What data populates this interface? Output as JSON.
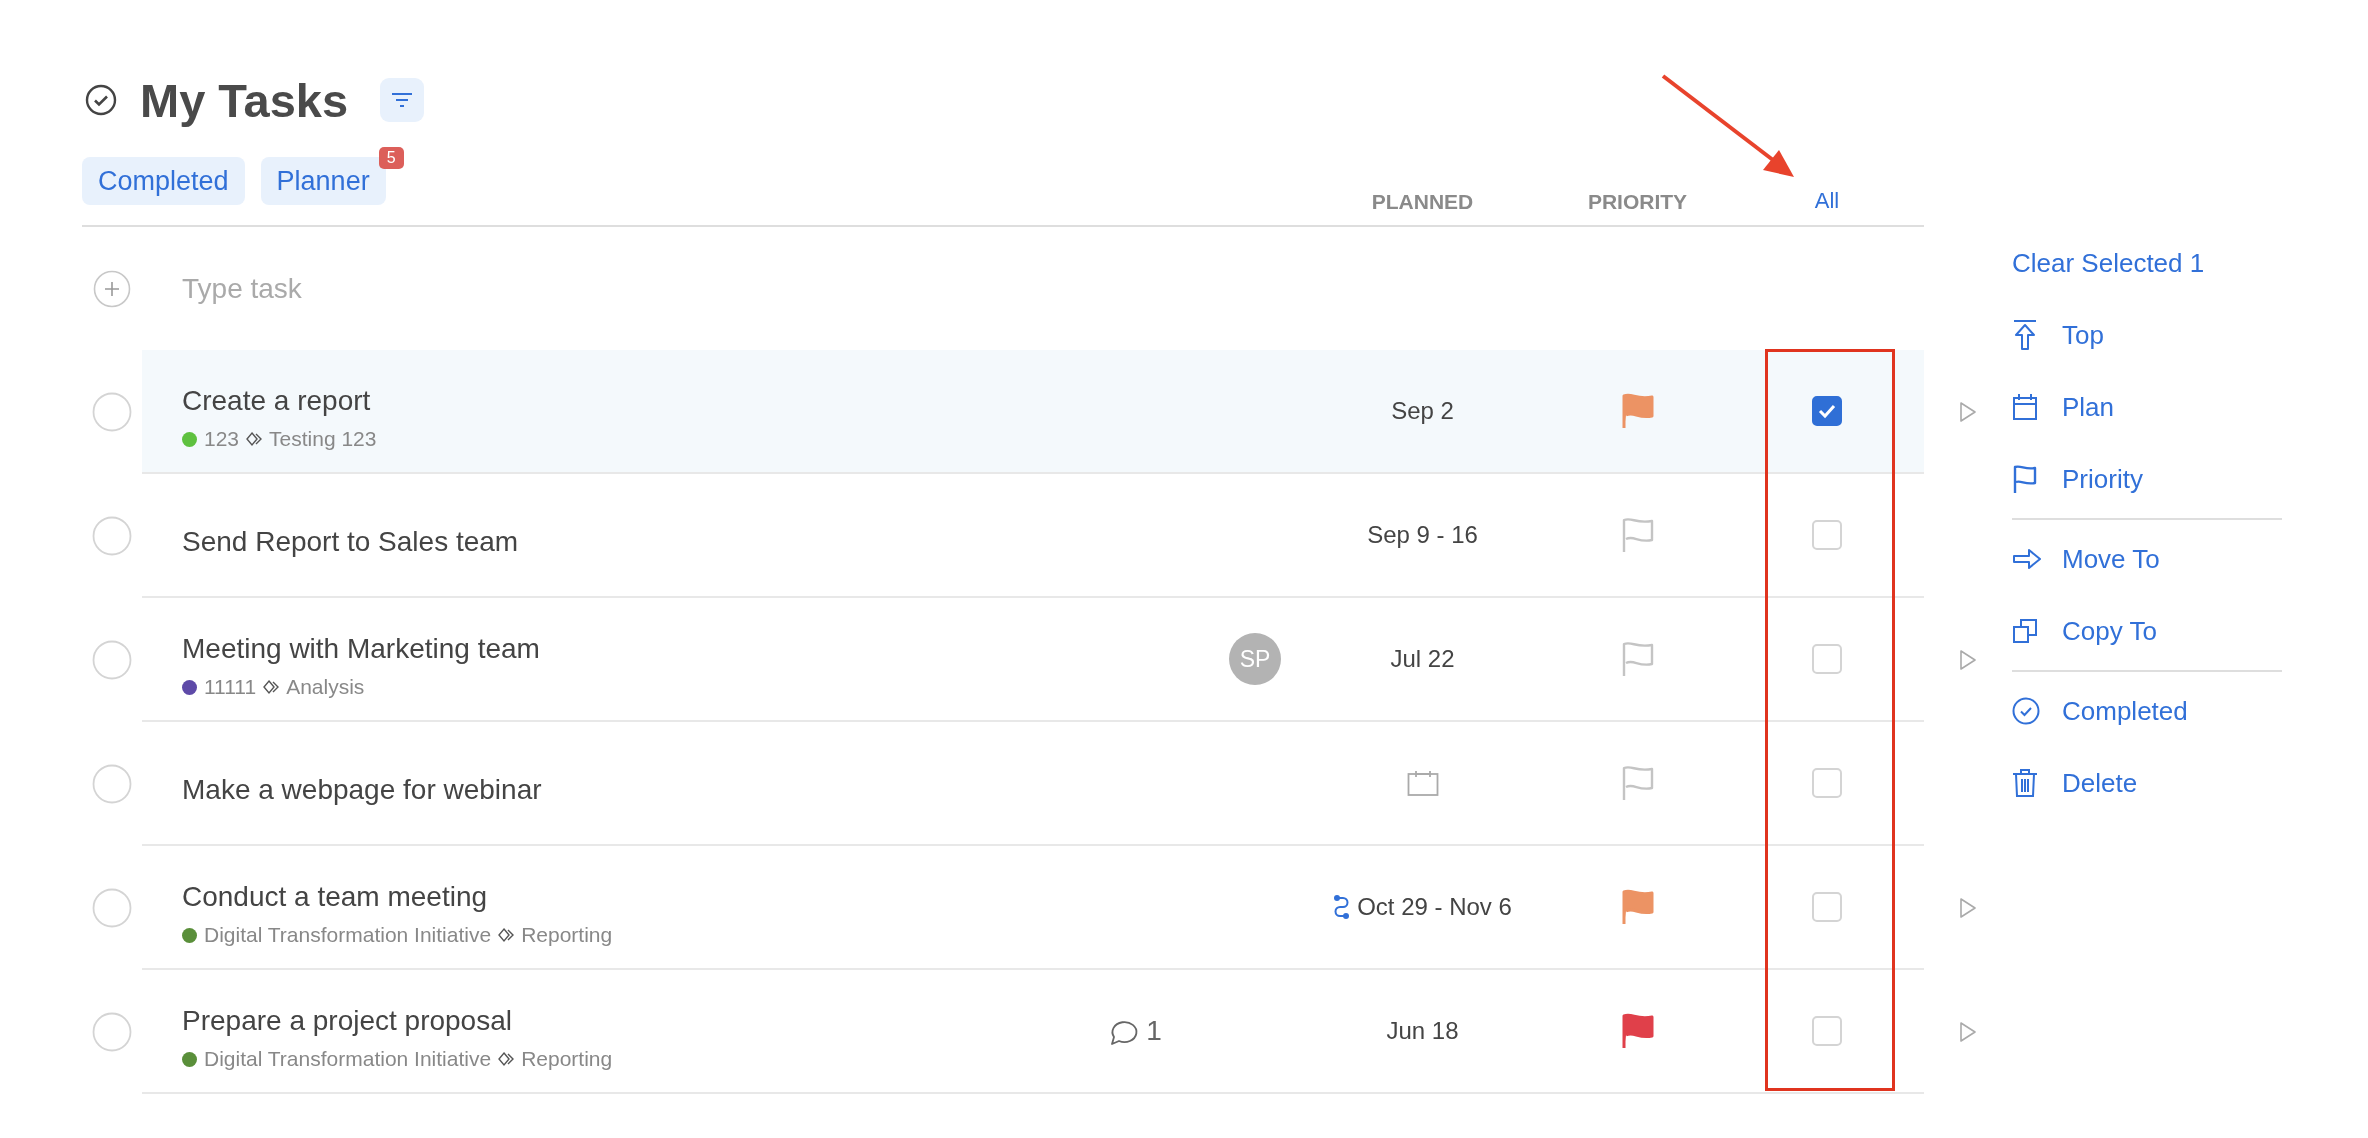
{
  "header": {
    "title": "My Tasks"
  },
  "filters": [
    {
      "label": "Completed"
    },
    {
      "label": "Planner",
      "badge": "5"
    }
  ],
  "columns": {
    "planned": "PLANNED",
    "priority": "PRIORITY",
    "select_all": "All"
  },
  "new_task": {
    "placeholder": "Type task"
  },
  "tasks": [
    {
      "title": "Create a report",
      "project": "123",
      "color": "#5ec13f",
      "section": "Testing 123",
      "planned": "Sep 2",
      "recurring": false,
      "priority": {
        "set": true,
        "color": "#ec9364"
      },
      "selected": true,
      "expandable": true
    },
    {
      "title": "Send Report to Sales team",
      "planned": "Sep 9 - 16",
      "recurring": false,
      "priority": {
        "set": false
      },
      "selected": false,
      "expandable": false
    },
    {
      "title": "Meeting with Marketing team",
      "project": "11111",
      "color": "#5e4aa8",
      "section": "Analysis",
      "assignee": "SP",
      "planned": "Jul 22",
      "recurring": false,
      "priority": {
        "set": false
      },
      "selected": false,
      "expandable": true
    },
    {
      "title": "Make a webpage for webinar",
      "recurring": false,
      "priority": {
        "set": false
      },
      "selected": false,
      "expandable": false
    },
    {
      "title": "Conduct a team meeting",
      "project": "Digital Transformation Initiative",
      "color": "#5a8f3a",
      "section": "Reporting",
      "planned": "Oct 29 - Nov 6",
      "recurring": true,
      "priority": {
        "set": true,
        "color": "#ec9364"
      },
      "selected": false,
      "expandable": true
    },
    {
      "title": "Prepare a project proposal",
      "project": "Digital Transformation Initiative",
      "color": "#5a8f3a",
      "section": "Reporting",
      "comments": "1",
      "planned": "Jun 18",
      "recurring": false,
      "priority": {
        "set": true,
        "color": "#e0404a"
      },
      "selected": false,
      "expandable": true
    }
  ],
  "actions": {
    "clear": "Clear Selected 1",
    "groups": [
      [
        {
          "kind": "top",
          "label": "Top"
        },
        {
          "kind": "plan",
          "label": "Plan"
        },
        {
          "kind": "priority",
          "label": "Priority"
        }
      ],
      [
        {
          "kind": "move",
          "label": "Move To"
        },
        {
          "kind": "copy",
          "label": "Copy To"
        }
      ],
      [
        {
          "kind": "completed",
          "label": "Completed"
        },
        {
          "kind": "delete",
          "label": "Delete"
        }
      ]
    ]
  }
}
